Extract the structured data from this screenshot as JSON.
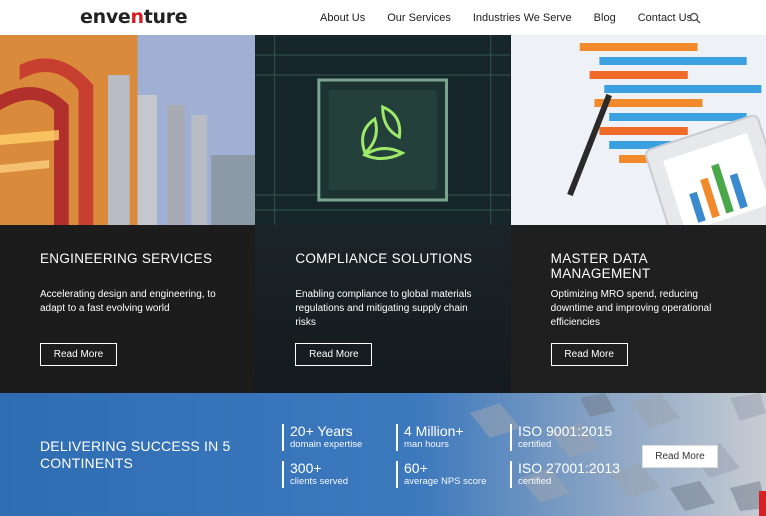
{
  "header": {
    "logo_pre": "enve",
    "logo_accent": "n",
    "logo_post": "ture",
    "nav": [
      "About Us",
      "Our Services",
      "Industries We Serve",
      "Blog",
      "Contact Us"
    ]
  },
  "panels": [
    {
      "title": "ENGINEERING SERVICES",
      "text": "Accelerating design and engineering, to adapt to a fast evolving world",
      "button": "Read More"
    },
    {
      "title": "COMPLIANCE SOLUTIONS",
      "text": "Enabling compliance to global materials regulations and mitigating supply chain risks",
      "button": "Read More"
    },
    {
      "title": "MASTER DATA MANAGEMENT",
      "text": "Optimizing MRO spend, reducing downtime and improving operational efficiencies",
      "button": "Read More"
    }
  ],
  "strip": {
    "tagline": "DELIVERING SUCCESS IN 5 CONTINENTS",
    "stats": [
      {
        "big": "20+ Years",
        "small": "domain expertise"
      },
      {
        "big": "4 Million+",
        "small": "man hours"
      },
      {
        "big": "ISO 9001:2015",
        "small": "certified"
      },
      {
        "big": "300+",
        "small": "clients served"
      },
      {
        "big": "60+",
        "small": "average NPS score"
      },
      {
        "big": "ISO 27001:2013",
        "small": "certified"
      }
    ],
    "button": "Read More"
  },
  "colors": {
    "accent": "#d71f26",
    "strip_blue": "#2f6db3",
    "panel_dark": "#1c1c1c"
  }
}
